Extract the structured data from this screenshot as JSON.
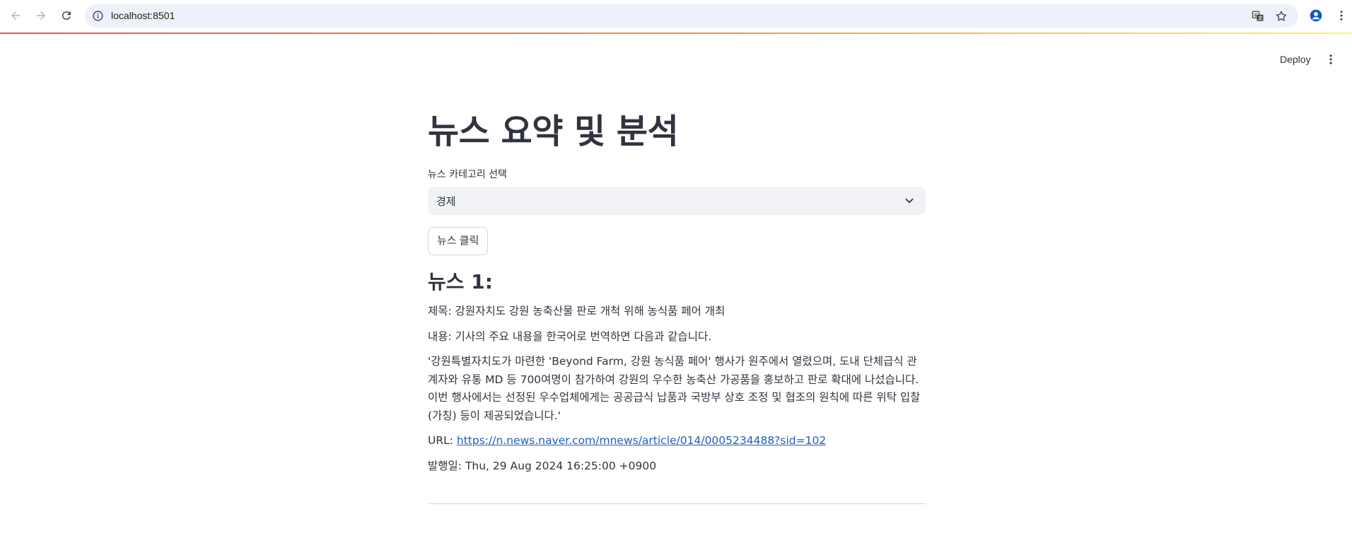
{
  "browser": {
    "url": "localhost:8501",
    "icons": {
      "back": "arrow-left-icon",
      "forward": "arrow-right-icon",
      "reload": "reload-icon",
      "site_info": "info-icon",
      "translate": "translate-icon",
      "bookmark": "star-icon",
      "profile": "profile-icon",
      "menu": "kebab-menu-icon"
    }
  },
  "header": {
    "deploy_label": "Deploy"
  },
  "main": {
    "title": "뉴스 요약 및 분석",
    "category_select": {
      "label": "뉴스 카테고리 선택",
      "value": "경제"
    },
    "news_button_label": "뉴스 클릭",
    "news": [
      {
        "heading": "뉴스 1:",
        "title_line": "제목: 강원자치도 강원 농축산물 판로 개척 위해 농식품 페어 개최",
        "content_line": "내용: 기사의 주요 내용을 한국어로 번역하면 다음과 같습니다.",
        "body": "'강원특별자치도가 마련한 'Beyond Farm, 강원 농식품 페어' 행사가 원주에서 열렸으며, 도내 단체급식 관계자와 유통 MD 등 700여명이 참가하여 강원의 우수한 농축산 가공품을 홍보하고 판로 확대에 나섰습니다. 이번 행사에서는 선정된 우수업체에게는 공공급식 납품과 국방부 상호 조정 및 협조의 원칙에 따른 위탁 입찰(가칭) 등이 제공되었습니다.'",
        "url_prefix": "URL: ",
        "url": "https://n.news.naver.com/mnews/article/014/0005234488?sid=102",
        "date_prefix": "발행일: ",
        "date": "Thu, 29 Aug 2024 16:25:00 +0900"
      }
    ]
  },
  "colors": {
    "text": "#31333f",
    "link": "#1f5fbf",
    "select_bg": "#f0f2f6",
    "omnibox_bg": "#edf1f9",
    "accent_start": "#ff4b4b",
    "accent_end": "#fff36b"
  }
}
